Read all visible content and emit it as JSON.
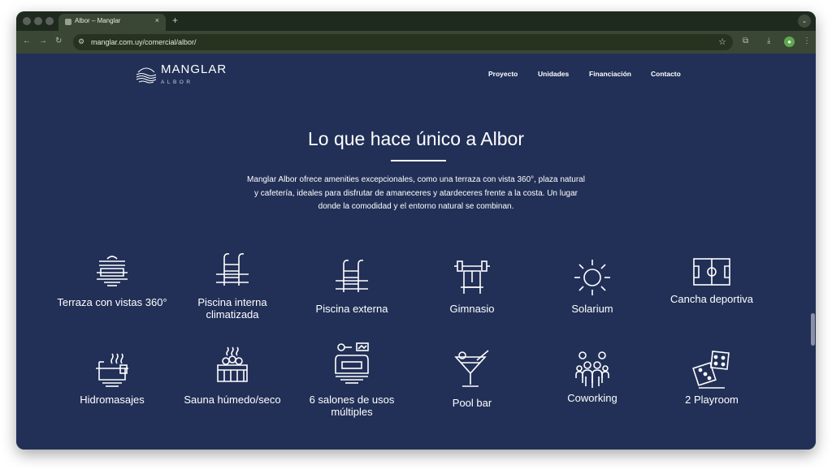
{
  "browser": {
    "tab_title": "Albor – Manglar",
    "tab_close": "×",
    "new_tab": "+",
    "url": "manglar.com.uy/comercial/albor/",
    "icons": [
      "back-arrow-icon",
      "forward-arrow-icon",
      "reload-icon",
      "site-info-icon",
      "star-icon",
      "extensions-icon",
      "download-icon",
      "profile-icon",
      "menu-dots-icon"
    ]
  },
  "site": {
    "logo_name": "MANGLAR",
    "logo_sub": "ALBOR",
    "nav": [
      "Proyecto",
      "Unidades",
      "Financiación",
      "Contacto"
    ]
  },
  "section": {
    "title": "Lo que hace único a Albor",
    "intro": "Manglar Albor ofrece amenities excepcionales, como una terraza con vista 360°, plaza natural y cafetería, ideales para disfrutar de amaneceres y atardeceres frente a la costa. Un lugar donde la comodidad y el entorno natural se combinan."
  },
  "amenities": [
    {
      "label": "Terraza con vistas 360°",
      "icon": "terrace-icon"
    },
    {
      "label": "Piscina interna climatizada",
      "icon": "pool-ladder-icon"
    },
    {
      "label": "Piscina externa",
      "icon": "pool-ladder-icon"
    },
    {
      "label": "Gimnasio",
      "icon": "dumbbell-icon"
    },
    {
      "label": "Solarium",
      "icon": "sun-icon"
    },
    {
      "label": "Cancha deportiva",
      "icon": "sports-court-icon"
    },
    {
      "label": "Hidromasajes",
      "icon": "hot-tub-icon"
    },
    {
      "label": "Sauna húmedo/seco",
      "icon": "sauna-icon"
    },
    {
      "label": "6 salones de usos múltiples",
      "icon": "sofa-icon"
    },
    {
      "label": "Pool bar",
      "icon": "cocktail-icon"
    },
    {
      "label": "Coworking",
      "icon": "people-group-icon"
    },
    {
      "label": "2 Playroom",
      "icon": "dice-icon"
    }
  ],
  "colors": {
    "page_background": "#223057",
    "text": "#ffffff",
    "browser_frame": "#3a4735"
  }
}
